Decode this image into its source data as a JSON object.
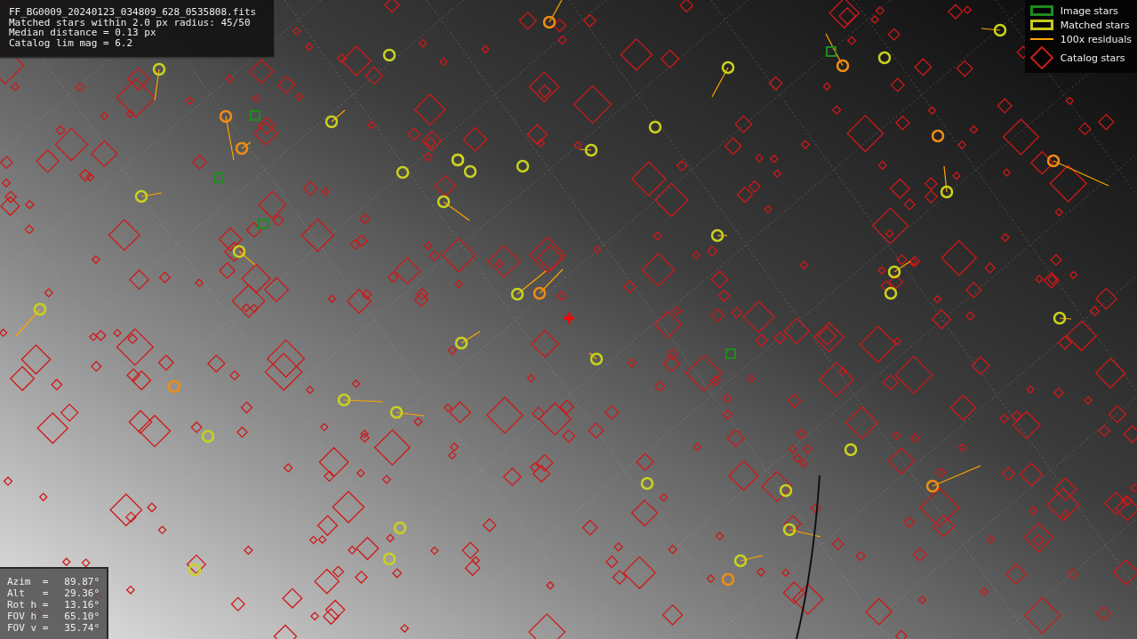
{
  "info_panel": {
    "lines": [
      "FF_BG0009_20240123_034809_628_0535808.fits",
      "Matched stars within 2.0 px radius: 45/50",
      "Median distance = 0.13 px",
      "Catalog lim mag = 6.2"
    ]
  },
  "legend": [
    {
      "kind": "image-box",
      "label": "Image stars",
      "color": "#1e8c1e"
    },
    {
      "kind": "matched-box",
      "label": "Matched stars",
      "color": "#c8c81e"
    },
    {
      "kind": "residual-line",
      "label": "100x residuals",
      "color": "#ffa500"
    },
    {
      "kind": "catalog-diamond",
      "label": "Catalog stars",
      "color": "#c81e1e"
    }
  ],
  "pointing_panel": {
    "rows": [
      {
        "label": "Azim  =",
        "value": "89.87°"
      },
      {
        "label": "Alt   =",
        "value": "29.36°"
      },
      {
        "label": "Rot h =",
        "value": "13.16°"
      },
      {
        "label": "FOV h =",
        "value": "65.10°"
      },
      {
        "label": "FOV v =",
        "value": "35.74°"
      }
    ]
  }
}
